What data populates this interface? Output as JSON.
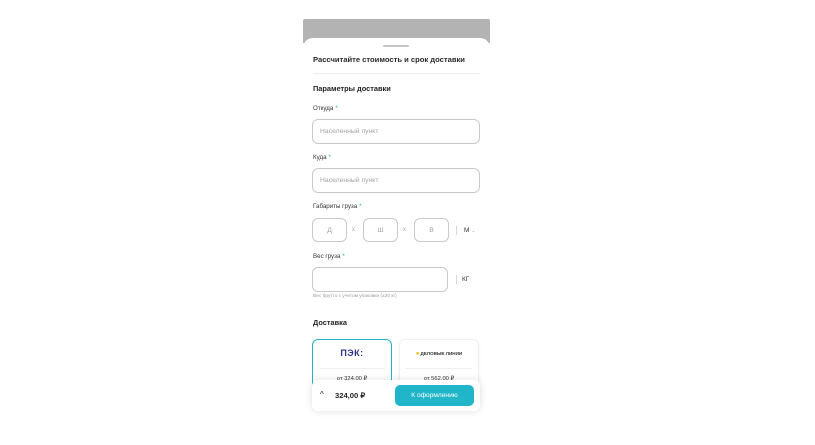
{
  "calculator": {
    "title": "Рассчитайте стоимость и срок доставки",
    "params_heading": "Параметры доставки",
    "required_mark": "*",
    "from": {
      "label": "Откуда",
      "placeholder": "Населенный пункт",
      "value": ""
    },
    "to": {
      "label": "Куда",
      "placeholder": "Населенный пункт",
      "value": ""
    },
    "dimensions": {
      "label": "Габариты груза",
      "length_placeholder": "Д",
      "width_placeholder": "Ш",
      "height_placeholder": "В",
      "separator": "x",
      "unit": "М",
      "unit_caret": "⌄"
    },
    "weight": {
      "label": "Вес груза",
      "value": "",
      "unit": "КГ",
      "hint": "Вес брутто с учетом упаковки (±20 кг)"
    },
    "delivery": {
      "heading": "Доставка",
      "carriers": [
        {
          "logo": "ПЭК:",
          "price": "от 324,00 ₽",
          "selected": true
        },
        {
          "logo": "ДЕЛОВЫЕ ЛИНИИ",
          "price": "от 562,00 ₽",
          "selected": false
        }
      ]
    }
  },
  "footer": {
    "chevron_icon": "chevron-up-icon",
    "chevron_glyph": "^",
    "total": "324,00 ₽",
    "checkout_label": "К оформлению"
  },
  "colors": {
    "accent": "#20b5c8",
    "overlay_top": "#b3b3b3"
  }
}
